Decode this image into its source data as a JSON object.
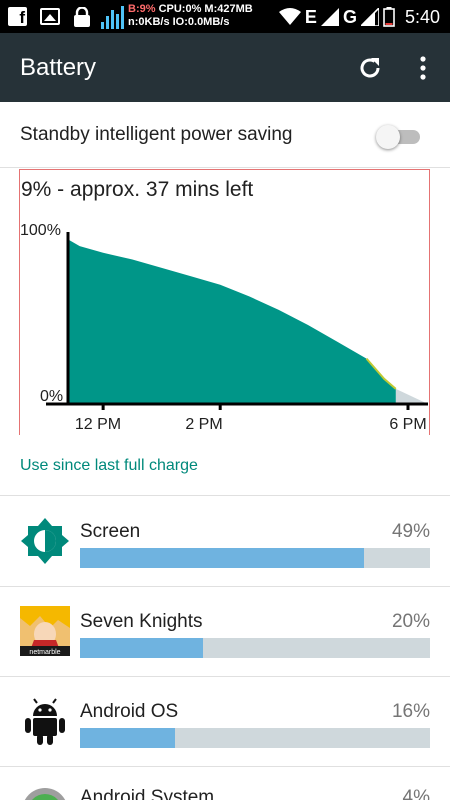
{
  "status_bar": {
    "cpu_overlay_line1_battery": "B:9%",
    "cpu_overlay_line1_rest": " CPU:0% M:427MB",
    "cpu_overlay_line2": "n:0KB/s IO:0.0MB/s",
    "network_letter_1": "E",
    "network_letter_2": "G",
    "time": "5:40",
    "icons": [
      "facebook-icon",
      "image-icon",
      "lock-icon",
      "signal-bars-icon",
      "wifi-icon",
      "cell-signal-icon",
      "battery-icon"
    ]
  },
  "app_bar": {
    "title": "Battery",
    "actions": [
      "refresh-icon",
      "overflow-menu-icon"
    ]
  },
  "standby": {
    "label": "Standby intelligent power saving",
    "enabled": false
  },
  "chart_data": {
    "type": "area",
    "title": "9% - approx. 37 mins left",
    "y_tick_labels": [
      "100%",
      "0%"
    ],
    "x_tick_labels": [
      "12 PM",
      "2 PM",
      "6 PM"
    ],
    "ylim": [
      0,
      100
    ],
    "x_hours": [
      11.4,
      11.6,
      12.0,
      12.5,
      13.0,
      13.5,
      14.0,
      14.5,
      15.0,
      15.5,
      16.0,
      16.5,
      16.8,
      17.0
    ],
    "y_percent": [
      98,
      94,
      90,
      86,
      81,
      76,
      71,
      64,
      56,
      47,
      37,
      27,
      15,
      9
    ],
    "projection_end_hour": 17.55,
    "colors": {
      "fill": "#009688",
      "projection": "#cfd8dc",
      "axis": "#000000",
      "low": "#c0ca33"
    }
  },
  "use_since_link": "Use since last full charge",
  "usage": [
    {
      "name": "Screen",
      "percent_label": "49%",
      "fraction": 0.81,
      "icon": "screen-brightness-icon"
    },
    {
      "name": "Seven Knights",
      "percent_label": "20%",
      "fraction": 0.35,
      "icon": "seven-knights-app-icon"
    },
    {
      "name": "Android OS",
      "percent_label": "16%",
      "fraction": 0.27,
      "icon": "android-icon"
    },
    {
      "name": "Android System",
      "percent_label": "4%",
      "icon": "android-system-icon"
    }
  ]
}
